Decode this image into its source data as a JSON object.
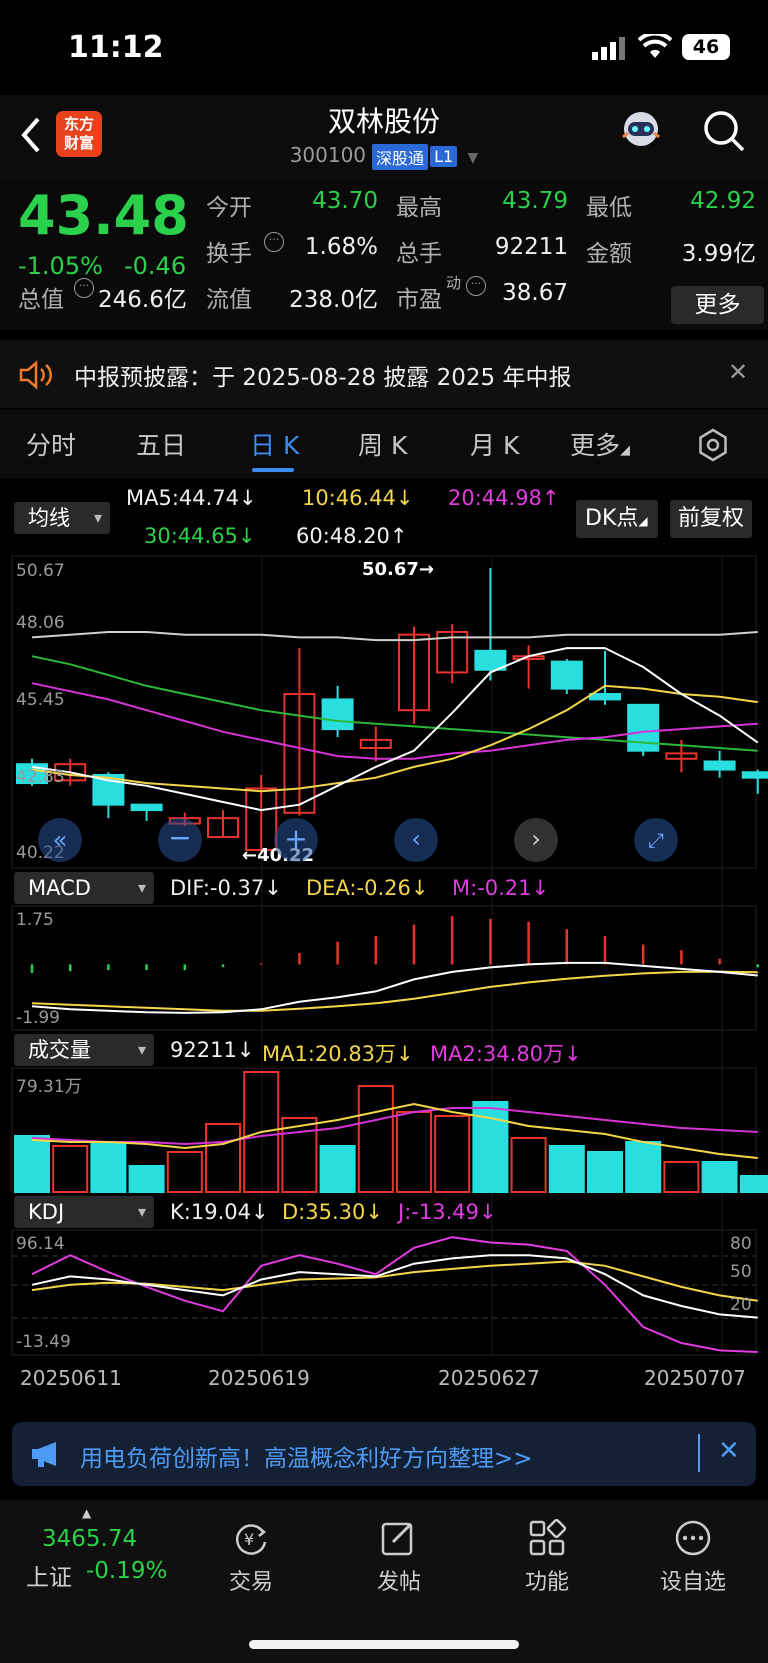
{
  "status_bar": {
    "time": "11:12",
    "battery": "46"
  },
  "header": {
    "logo": "东方\n财富",
    "title": "双林股份",
    "code": "300100",
    "tag1": "深股通",
    "tag2": "L1"
  },
  "quote": {
    "price": "43.48",
    "change_pct": "-1.05%",
    "change": "-0.46",
    "open_label": "今开",
    "open": "43.70",
    "high_label": "最高",
    "high": "43.79",
    "low_label": "最低",
    "low": "42.92",
    "turnover_label": "换手",
    "turnover": "1.68%",
    "volume_label": "总手",
    "volume": "92211",
    "amount_label": "金额",
    "amount": "3.99亿",
    "mktcap_label": "总值",
    "mktcap": "246.6亿",
    "float_label": "流值",
    "float": "238.0亿",
    "pe_label": "市盈",
    "pe_sup": "动",
    "pe": "38.67",
    "more": "更多"
  },
  "notice": {
    "text": "中报预披露：于 2025-08-28 披露 2025 年中报"
  },
  "tabs": [
    "分时",
    "五日",
    "日 K",
    "周 K",
    "月 K",
    "更多"
  ],
  "ma_panel": {
    "selector": "均线",
    "ma5": "MA5:44.74↓",
    "ma10": "10:46.44↓",
    "ma20": "20:44.98↑",
    "ma30": "30:44.65↓",
    "ma60": "60:48.20↑",
    "dk": "DK点",
    "fq": "前复权",
    "y_labels": [
      "50.67",
      "48.06",
      "45.45",
      "42.83",
      "40.22"
    ],
    "high_mark": "50.67→",
    "low_mark": "←40.22"
  },
  "macd_panel": {
    "selector": "MACD",
    "dif": "DIF:-0.37↓",
    "dea": "DEA:-0.26↓",
    "m": "M:-0.21↓",
    "y_top": "1.75",
    "y_bottom": "-1.99"
  },
  "vol_panel": {
    "selector": "成交量",
    "vol": "92211↓",
    "ma1": "MA1:20.83万↓",
    "ma2": "MA2:34.80万↓",
    "y_top": "79.31万"
  },
  "kdj_panel": {
    "selector": "KDJ",
    "k": "K:19.04↓",
    "d": "D:35.30↓",
    "j": "J:-13.49↓",
    "y_top": "96.14",
    "y_bottom": "-13.49",
    "r80": "80",
    "r50": "50",
    "r20": "20"
  },
  "dates": [
    "20250611",
    "20250619",
    "20250627",
    "20250707"
  ],
  "banner": {
    "text": "用电负荷创新高！高温概念利好方向整理>>"
  },
  "bottom_nav": {
    "index_value": "3465.74",
    "index_name": "上证",
    "index_change": "-0.19%",
    "items": [
      "交易",
      "发帖",
      "功能",
      "设自选"
    ]
  },
  "colors": {
    "up": "#e8342c",
    "down": "#28dede",
    "green": "#2bd14a",
    "accent": "#3b8cf0"
  },
  "chart_data": {
    "type": "candlestick",
    "candles": [
      {
        "o": 43.4,
        "c": 42.7,
        "h": 43.6,
        "l": 42.6
      },
      {
        "o": 42.8,
        "c": 43.4,
        "h": 43.6,
        "l": 42.6
      },
      {
        "o": 43.0,
        "c": 41.9,
        "h": 43.1,
        "l": 41.4
      },
      {
        "o": 41.9,
        "c": 41.7,
        "h": 41.9,
        "l": 41.3
      },
      {
        "o": 41.2,
        "c": 41.4,
        "h": 41.6,
        "l": 41.1
      },
      {
        "o": 40.7,
        "c": 41.4,
        "h": 41.7,
        "l": 40.7
      },
      {
        "o": 40.22,
        "c": 42.5,
        "h": 43.0,
        "l": 40.22
      },
      {
        "o": 41.6,
        "c": 46.0,
        "h": 47.7,
        "l": 41.5
      },
      {
        "o": 45.8,
        "c": 44.7,
        "h": 46.3,
        "l": 44.4
      },
      {
        "o": 44.0,
        "c": 44.3,
        "h": 44.8,
        "l": 43.5
      },
      {
        "o": 45.4,
        "c": 48.2,
        "h": 48.5,
        "l": 44.9
      },
      {
        "o": 46.8,
        "c": 48.3,
        "h": 48.6,
        "l": 46.4
      },
      {
        "o": 47.6,
        "c": 46.9,
        "h": 50.67,
        "l": 46.5
      },
      {
        "o": 47.3,
        "c": 47.4,
        "h": 47.8,
        "l": 46.2
      },
      {
        "o": 47.2,
        "c": 46.2,
        "h": 47.3,
        "l": 46.0
      },
      {
        "o": 46.0,
        "c": 45.8,
        "h": 47.6,
        "l": 45.6
      },
      {
        "o": 45.6,
        "c": 43.9,
        "h": 45.6,
        "l": 43.7
      },
      {
        "o": 43.6,
        "c": 43.8,
        "h": 44.3,
        "l": 43.1
      },
      {
        "o": 43.5,
        "c": 43.2,
        "h": 43.9,
        "l": 42.9
      },
      {
        "o": 43.1,
        "c": 42.9,
        "h": 43.2,
        "l": 42.3
      }
    ],
    "ma5": [
      43.3,
      43.1,
      42.8,
      42.6,
      42.3,
      42.0,
      41.7,
      41.9,
      42.6,
      43.3,
      43.9,
      45.3,
      46.8,
      47.4,
      47.7,
      47.7,
      47.0,
      46.0,
      45.2,
      44.2
    ],
    "ma10": [
      43.2,
      43.0,
      42.9,
      42.7,
      42.6,
      42.5,
      42.4,
      42.5,
      42.7,
      42.9,
      43.3,
      43.6,
      44.1,
      44.7,
      45.4,
      46.3,
      46.2,
      46.0,
      45.9,
      45.7
    ],
    "ma20": [
      46.4,
      46.1,
      45.8,
      45.4,
      45.0,
      44.6,
      44.3,
      44.0,
      43.7,
      43.6,
      43.6,
      43.8,
      43.9,
      44.1,
      44.3,
      44.4,
      44.6,
      44.7,
      44.8,
      44.9
    ],
    "ma30": [
      47.4,
      47.1,
      46.7,
      46.3,
      46.0,
      45.7,
      45.4,
      45.2,
      45.0,
      44.9,
      44.8,
      44.7,
      44.6,
      44.5,
      44.4,
      44.3,
      44.2,
      44.1,
      44.0,
      43.9
    ],
    "ma60": [
      48.1,
      48.2,
      48.3,
      48.3,
      48.2,
      48.2,
      48.2,
      48.1,
      48.1,
      48.0,
      48.0,
      48.1,
      48.1,
      48.1,
      48.2,
      48.2,
      48.2,
      48.2,
      48.2,
      48.3
    ],
    "macd_m": [
      -0.15,
      -0.12,
      -0.1,
      -0.1,
      -0.1,
      -0.05,
      0.02,
      0.2,
      0.4,
      0.5,
      0.7,
      0.85,
      0.8,
      0.75,
      0.62,
      0.5,
      0.35,
      0.25,
      0.1,
      -0.05
    ],
    "dif": [
      -1.4,
      -1.5,
      -1.55,
      -1.6,
      -1.62,
      -1.6,
      -1.5,
      -1.25,
      -1.1,
      -0.9,
      -0.5,
      -0.25,
      -0.1,
      0.0,
      0.05,
      0.05,
      -0.05,
      -0.15,
      -0.25,
      -0.37
    ],
    "dea": [
      -1.3,
      -1.35,
      -1.4,
      -1.45,
      -1.5,
      -1.55,
      -1.55,
      -1.48,
      -1.4,
      -1.3,
      -1.15,
      -0.95,
      -0.75,
      -0.6,
      -0.48,
      -0.38,
      -0.3,
      -0.25,
      -0.24,
      -0.26
    ],
    "volume": [
      28,
      23,
      25,
      13,
      20,
      34,
      60,
      37,
      23,
      53,
      40,
      38,
      45,
      27,
      23,
      20,
      25,
      15,
      15,
      8
    ],
    "vol_ma1": [
      26,
      25,
      25,
      24,
      22,
      24,
      30,
      33,
      36,
      40,
      44,
      40,
      37,
      33,
      31,
      29,
      25,
      22,
      19,
      17
    ],
    "vol_ma2": [
      27,
      26,
      25,
      25,
      24,
      25,
      28,
      30,
      32,
      36,
      40,
      42,
      42,
      40,
      38,
      36,
      34,
      32,
      31,
      30
    ],
    "k": [
      50,
      58,
      55,
      50,
      45,
      40,
      55,
      62,
      60,
      58,
      70,
      75,
      78,
      78,
      75,
      60,
      40,
      30,
      22,
      19
    ],
    "d": [
      45,
      50,
      52,
      51,
      48,
      45,
      50,
      55,
      56,
      57,
      62,
      65,
      68,
      70,
      72,
      68,
      58,
      48,
      40,
      35
    ],
    "j": [
      60,
      78,
      62,
      48,
      35,
      25,
      68,
      78,
      70,
      60,
      85,
      95,
      90,
      88,
      82,
      50,
      10,
      -5,
      -12,
      -13.49
    ],
    "y_range": [
      40.22,
      50.67
    ],
    "macd_range": [
      -1.99,
      1.75
    ],
    "kdj_range": [
      -13.49,
      96.14
    ]
  }
}
